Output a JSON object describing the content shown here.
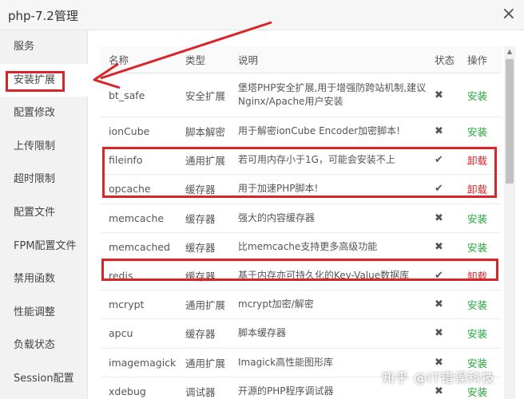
{
  "window": {
    "title": "php-7.2管理",
    "close_icon": "×"
  },
  "sidebar": {
    "items": [
      {
        "label": "服务"
      },
      {
        "label": "安装扩展"
      },
      {
        "label": "配置修改"
      },
      {
        "label": "上传限制"
      },
      {
        "label": "超时限制"
      },
      {
        "label": "配置文件"
      },
      {
        "label": "FPM配置文件"
      },
      {
        "label": "禁用函数"
      },
      {
        "label": "性能调整"
      },
      {
        "label": "负载状态"
      },
      {
        "label": "Session配置"
      }
    ],
    "active_index": 1
  },
  "table": {
    "headers": [
      "名称",
      "类型",
      "说明",
      "状态",
      "操作"
    ],
    "rows": [
      {
        "name": "bt_safe",
        "type": "安全扩展",
        "desc": "堡塔PHP安全扩展,用于增强防跨站机制,建议Nginx/Apache用户安装",
        "status": "✖",
        "action": "安装"
      },
      {
        "name": "ionCube",
        "type": "脚本解密",
        "desc": "用于解密ionCube Encoder加密脚本!",
        "status": "✖",
        "action": "安装"
      },
      {
        "name": "fileinfo",
        "type": "通用扩展",
        "desc": "若可用内存小于1G，可能会安装不上",
        "status": "✔",
        "action": "卸载"
      },
      {
        "name": "opcache",
        "type": "缓存器",
        "desc": "用于加速PHP脚本!",
        "status": "✔",
        "action": "卸载"
      },
      {
        "name": "memcache",
        "type": "缓存器",
        "desc": "强大的内容缓存器",
        "status": "✖",
        "action": "安装"
      },
      {
        "name": "memcached",
        "type": "缓存器",
        "desc": "比memcache支持更多高级功能",
        "status": "✖",
        "action": "安装"
      },
      {
        "name": "redis",
        "type": "缓存器",
        "desc": "基于内存亦可持久化的Key-Value数据库",
        "status": "✔",
        "action": "卸载"
      },
      {
        "name": "mcrypt",
        "type": "通用扩展",
        "desc": "mcrypt加密/解密",
        "status": "✖",
        "action": "安装"
      },
      {
        "name": "apcu",
        "type": "缓存器",
        "desc": "脚本缓存器",
        "status": "✖",
        "action": "安装"
      },
      {
        "name": "imagemagick",
        "type": "通用扩展",
        "desc": "Imagick高性能图形库",
        "status": "✖",
        "action": "安装"
      },
      {
        "name": "xdebug",
        "type": "调试器",
        "desc": "开源的PHP程序调试器",
        "status": "✖",
        "action": "安装"
      }
    ]
  },
  "watermark": "知乎 @IT错误科技",
  "colors": {
    "install": "#20a53a",
    "uninstall": "#d9252a",
    "highlight": "#d9252a"
  }
}
